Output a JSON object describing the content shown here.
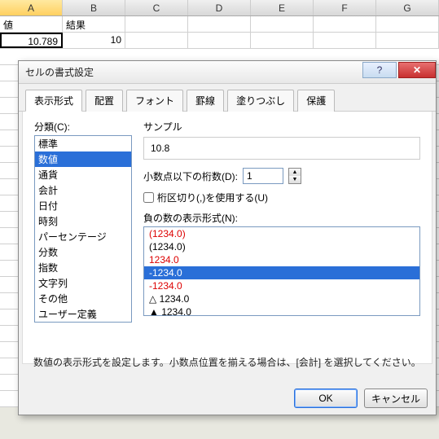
{
  "sheet": {
    "columns": [
      "A",
      "B",
      "C",
      "D",
      "E",
      "F",
      "G"
    ],
    "rows": [
      {
        "a": "値",
        "b": "結果"
      },
      {
        "a": "10.789",
        "b": "10"
      }
    ]
  },
  "dialog": {
    "title": "セルの書式設定",
    "tabs": [
      "表示形式",
      "配置",
      "フォント",
      "罫線",
      "塗りつぶし",
      "保護"
    ],
    "active_tab": 0,
    "category_label": "分類(C):",
    "categories": [
      "標準",
      "数値",
      "通貨",
      "会計",
      "日付",
      "時刻",
      "パーセンテージ",
      "分数",
      "指数",
      "文字列",
      "その他",
      "ユーザー定義"
    ],
    "category_selected": 1,
    "sample_label": "サンプル",
    "sample_value": "10.8",
    "decimal_label": "小数点以下の桁数(D):",
    "decimal_value": "1",
    "thousand_sep_label": "桁区切り(,)を使用する(U)",
    "thousand_sep_checked": false,
    "negative_label": "負の数の表示形式(N):",
    "negative_formats": [
      {
        "text": "(1234.0)",
        "red": true
      },
      {
        "text": "(1234.0)",
        "red": false
      },
      {
        "text": "1234.0",
        "red": true
      },
      {
        "text": "-1234.0",
        "red": false,
        "selected": true
      },
      {
        "text": "-1234.0",
        "red": true
      },
      {
        "text": "△ 1234.0",
        "red": false
      },
      {
        "text": "▲ 1234.0",
        "red": false
      }
    ],
    "help_text": "数値の表示形式を設定します。小数点位置を揃える場合は、[会計] を選択してください。",
    "ok_label": "OK",
    "cancel_label": "キャンセル"
  }
}
